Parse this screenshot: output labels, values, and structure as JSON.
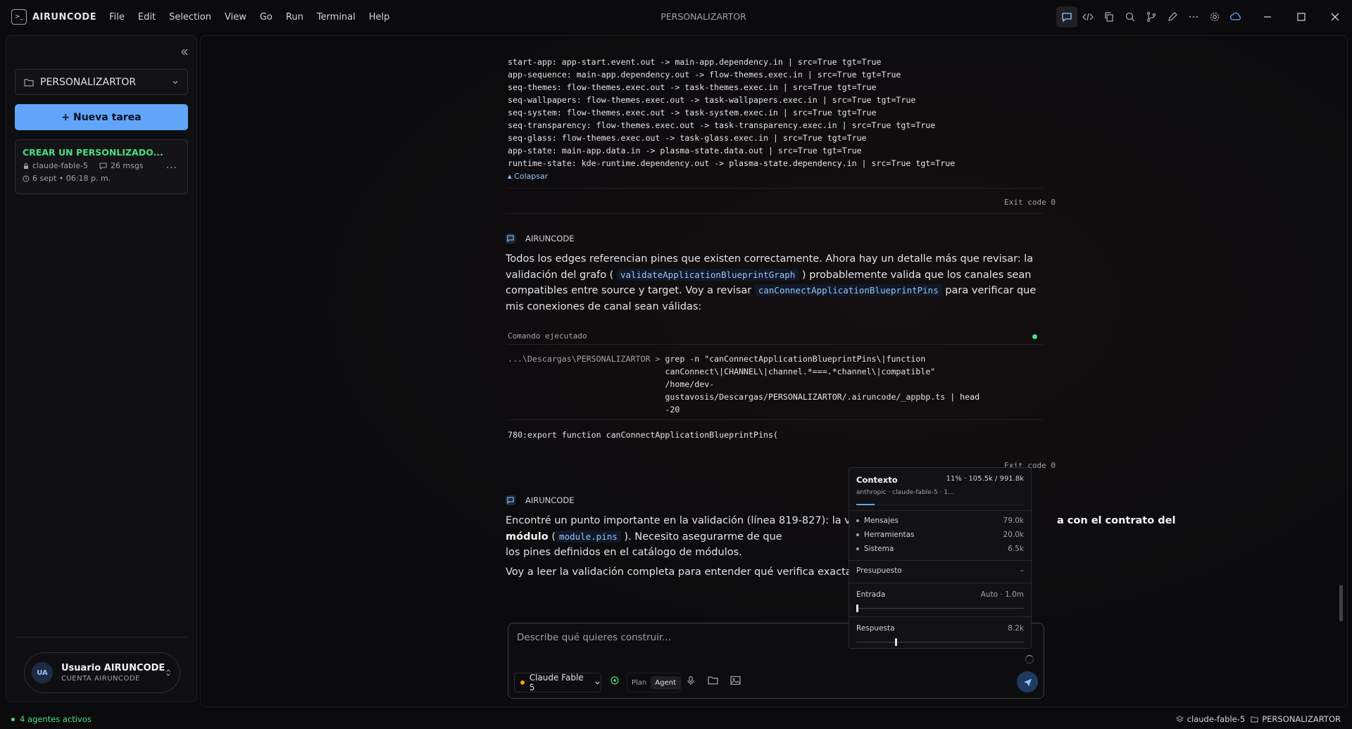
{
  "app": {
    "name": "AIRUNCODE",
    "window_title": "PERSONALIZARTOR"
  },
  "menu": [
    "File",
    "Edit",
    "Selection",
    "View",
    "Go",
    "Run",
    "Terminal",
    "Help"
  ],
  "sidebar": {
    "project": "PERSONALIZARTOR",
    "new_task": "+ Nueva tarea",
    "task": {
      "title": "CREAR UN PERSONLIZADO...",
      "model": "claude-fable-5",
      "msgs": "26 msgs",
      "date": "6 sept • 06:18 p. m."
    },
    "user": {
      "initials": "UA",
      "name": "Usuario AIRUNCODE",
      "subtitle": "CUENTA AIRUNCODE"
    }
  },
  "chat": {
    "code_lines": [
      "start-app: app-start.event.out -> main-app.dependency.in | src=True tgt=True",
      "app-sequence: main-app.dependency.out -> flow-themes.exec.in | src=True tgt=True",
      "seq-themes: flow-themes.exec.out -> task-themes.exec.in | src=True tgt=True",
      "seq-wallpapers: flow-themes.exec.out -> task-wallpapers.exec.in | src=True tgt=True",
      "seq-system: flow-themes.exec.out -> task-system.exec.in | src=True tgt=True",
      "seq-transparency: flow-themes.exec.out -> task-transparency.exec.in | src=True tgt=True",
      "seq-glass: flow-themes.exec.out -> task-glass.exec.in | src=True tgt=True",
      "app-state: main-app.data.in -> plasma-state.data.out | src=True tgt=True",
      "runtime-state: kde-runtime.dependency.out -> plasma-state.dependency.in | src=True tgt=True"
    ],
    "collapse": "Colapsar",
    "exit_code": "Exit code 0",
    "author": "AIRUNCODE",
    "msg1": {
      "t1": "Todos los edges referencian pines que existen correctamente. Ahora hay un detalle más que revisar: la validación del grafo (",
      "c1": "validateApplicationBlueprintGraph",
      "t2": ") probablemente valida que los canales sean compatibles entre source y target. Voy a revisar",
      "c2": "canConnectApplicationBlueprintPins",
      "t3": "para verificar que mis conexiones de canal sean válidas:"
    },
    "command": {
      "label": "Comando ejecutado",
      "prompt": "...\\Descargas\\PERSONALIZARTOR > ",
      "text": "grep -n \"canConnectApplicationBlueprintPins\\|function canConnect\\|CHANNEL\\|channel.*===.*channel\\|compatible\" /home/dev-gustavosis/Descargas/PERSONALIZARTOR/.airuncode/_appbp.ts | head -20",
      "output": "780:export function canConnectApplicationBlueprintPins("
    },
    "msg2": {
      "t1": "Encontré un punto importante en la validación (línea 819-827): la validación",
      "b1": "a con el contrato del módulo",
      "t1b": " (",
      "c1": "module.pins",
      "t2": "). Necesito asegurarme de que",
      "t3": "los pines definidos en el catálogo de módulos.",
      "p2": "Voy a leer la validación completa para entender qué verifica exactamente ("
    },
    "input_placeholder": "Describe qué quieres construir...",
    "model": "Claude Fable 5",
    "mode_plan": "Plan",
    "mode_agent": "Agent"
  },
  "context": {
    "title": "Contexto",
    "usage": "11% · 105.5k / 991.8k",
    "provider": "anthropic · claude-fable-5 · 1...",
    "usage_fraction": 0.11,
    "items": [
      {
        "label": "Mensajes",
        "value": "79.0k"
      },
      {
        "label": "Herramientas",
        "value": "20.0k"
      },
      {
        "label": "Sistema",
        "value": "6.5k"
      }
    ],
    "budget_label": "Presupuesto",
    "budget_value": "–",
    "input_label": "Entrada",
    "input_value": "Auto · 1.0m",
    "input_fraction": 0.0,
    "response_label": "Respuesta",
    "response_value": "8.2k",
    "response_fraction": 0.23
  },
  "status": {
    "agents": "4 agentes activos",
    "model": "claude-fable-5",
    "project": "PERSONALIZARTOR"
  }
}
